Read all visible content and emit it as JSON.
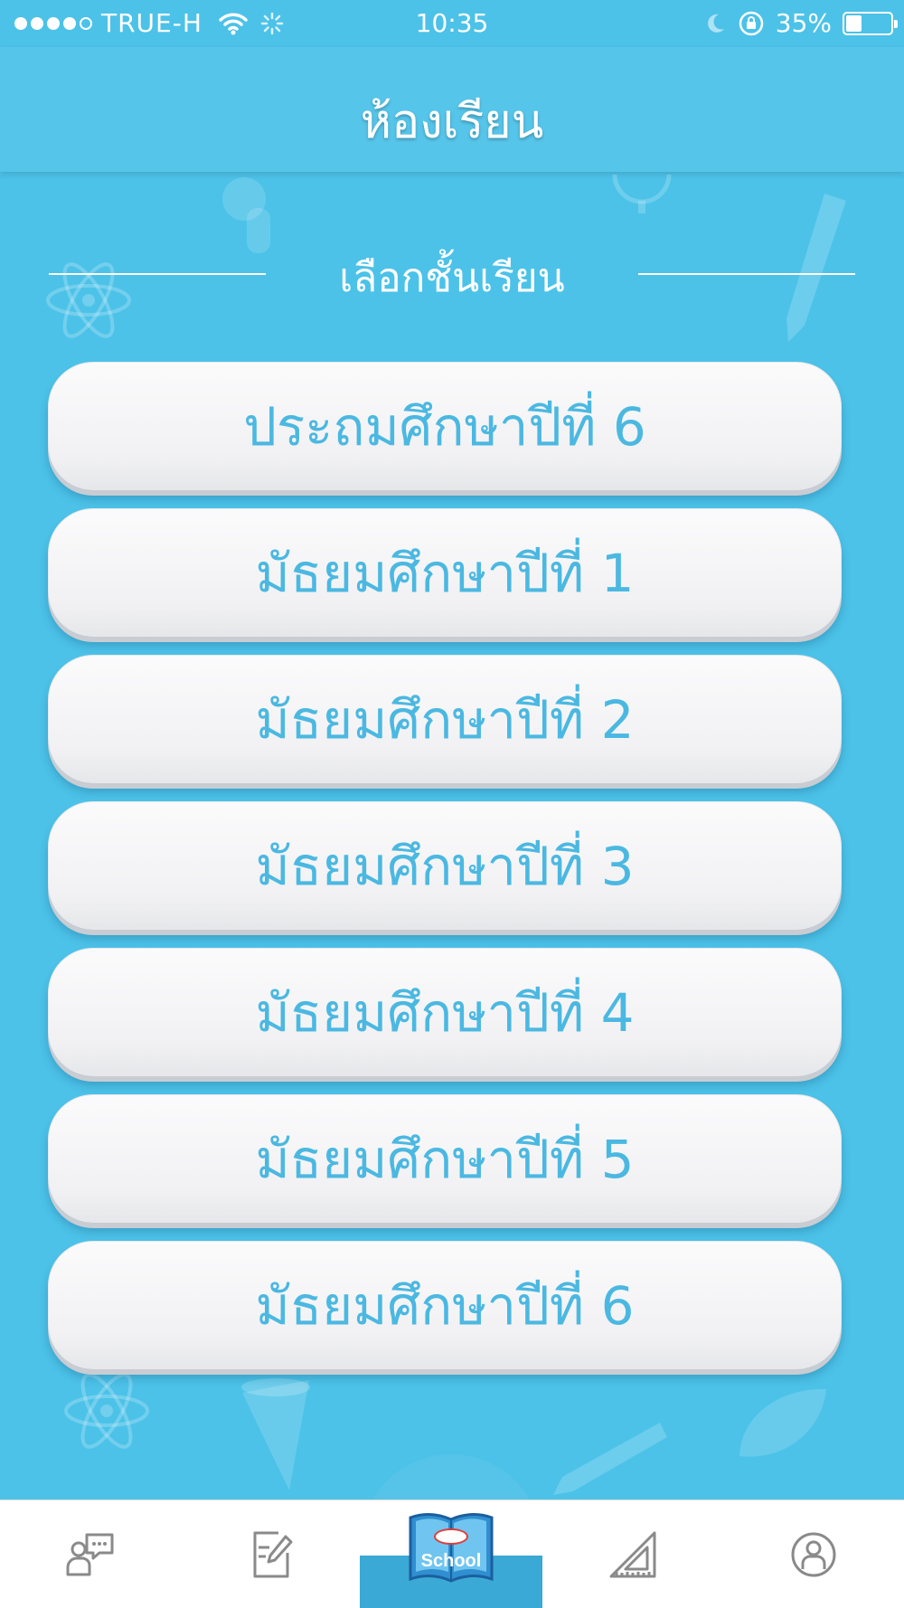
{
  "status_bar": {
    "carrier": "TRUE-H",
    "time": "10:35",
    "battery_text": "35%",
    "battery_level": 0.35,
    "signal_bars_filled": 4,
    "signal_bars_total": 5
  },
  "header": {
    "title": "ห้องเรียน"
  },
  "section": {
    "title": "เลือกชั้นเรียน"
  },
  "grades": [
    {
      "label": "ประถมศึกษาปีที่ 6"
    },
    {
      "label": "มัธยมศึกษาปีที่ 1"
    },
    {
      "label": "มัธยมศึกษาปีที่ 2"
    },
    {
      "label": "มัธยมศึกษาปีที่ 3"
    },
    {
      "label": "มัธยมศึกษาปีที่ 4"
    },
    {
      "label": "มัธยมศึกษาปีที่ 5"
    },
    {
      "label": "มัธยมศึกษาปีที่ 6"
    }
  ],
  "tab_bar": {
    "center_logo_text": "School",
    "tabs": [
      {
        "icon": "teacher-chat-icon"
      },
      {
        "icon": "edit-document-icon"
      },
      {
        "icon": "school-book-logo"
      },
      {
        "icon": "set-square-icon"
      },
      {
        "icon": "profile-icon"
      }
    ]
  },
  "colors": {
    "background": "#4cc2e8",
    "header": "#56c5ea",
    "button_text": "#4bb8e1",
    "tab_icon": "#8a8a8a"
  }
}
